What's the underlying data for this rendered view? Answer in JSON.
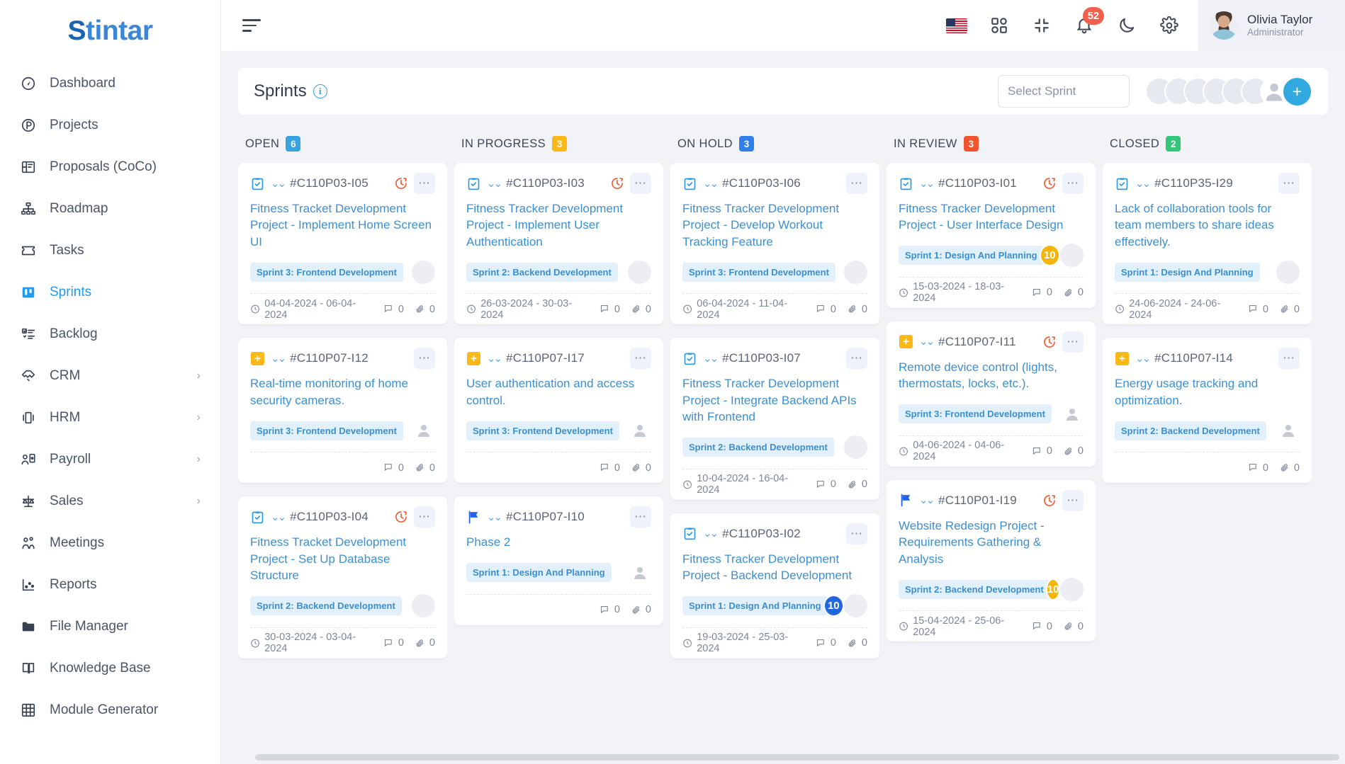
{
  "brand": {
    "mark": "S",
    "rest": "tintar",
    "full": "Stintar"
  },
  "sidebar": {
    "items": [
      {
        "label": "Dashboard",
        "icon": "speedometer-icon",
        "active": false,
        "chevron": false
      },
      {
        "label": "Projects",
        "icon": "circle-p-icon",
        "active": false,
        "chevron": false
      },
      {
        "label": "Proposals (CoCo)",
        "icon": "proposal-icon",
        "active": false,
        "chevron": false
      },
      {
        "label": "Roadmap",
        "icon": "sitemap-icon",
        "active": false,
        "chevron": false
      },
      {
        "label": "Tasks",
        "icon": "ticket-icon",
        "active": false,
        "chevron": false
      },
      {
        "label": "Sprints",
        "icon": "board-icon",
        "active": true,
        "chevron": false
      },
      {
        "label": "Backlog",
        "icon": "checklist-icon",
        "active": false,
        "chevron": false
      },
      {
        "label": "CRM",
        "icon": "handshake-icon",
        "active": false,
        "chevron": true
      },
      {
        "label": "HRM",
        "icon": "hrm-icon",
        "active": false,
        "chevron": true
      },
      {
        "label": "Payroll",
        "icon": "payroll-icon",
        "active": false,
        "chevron": true
      },
      {
        "label": "Sales",
        "icon": "scales-icon",
        "active": false,
        "chevron": true
      },
      {
        "label": "Meetings",
        "icon": "people-icon",
        "active": false,
        "chevron": false
      },
      {
        "label": "Reports",
        "icon": "chart-icon",
        "active": false,
        "chevron": false
      },
      {
        "label": "File Manager",
        "icon": "folder-icon",
        "active": false,
        "chevron": false
      },
      {
        "label": "Knowledge Base",
        "icon": "book-icon",
        "active": false,
        "chevron": false
      },
      {
        "label": "Module Generator",
        "icon": "grid-icon",
        "active": false,
        "chevron": false
      }
    ]
  },
  "topbar": {
    "menu_toggle": "hamburger-icon",
    "language_flag": "us-flag-icon",
    "apps": "apps-grid-icon",
    "fullscreen": "compress-icon",
    "notifications": {
      "icon": "bell-icon",
      "count": "52"
    },
    "theme": "moon-icon",
    "settings": "gear-icon",
    "user": {
      "name": "Olivia Taylor",
      "role": "Administrator",
      "avatar": "user-avatar"
    }
  },
  "sprints_header": {
    "title": "Sprints",
    "info_icon": "info-icon",
    "select_placeholder": "Select Sprint",
    "select_value": "",
    "member_count": 6,
    "add_member_label": "+"
  },
  "colors": {
    "open": "#36a2e0",
    "in_progress": "#fcb816",
    "on_hold": "#2f80ed",
    "in_review": "#f2542d",
    "closed": "#34c77b",
    "accent": "#31a8e0",
    "link": "#3d8fd4",
    "notification": "#f25f4c"
  },
  "board": {
    "columns": [
      {
        "title": "OPEN",
        "count": "6",
        "color": "#36a2e0",
        "cards": [
          {
            "type_icon": "task-check-icon",
            "id": "#C110P03-I05",
            "overdue": true,
            "title": "Fitness Tracket Development Project - Implement Home Screen UI",
            "sprint": "Sprint 3: Frontend Development",
            "badge": null,
            "assignee": true,
            "dates": "04-04-2024 - 06-04-2024",
            "comments": "0",
            "attachments": "0"
          },
          {
            "type_icon": "plus-square-icon",
            "id": "#C110P07-I12",
            "overdue": false,
            "title": "Real-time monitoring of home security cameras.",
            "sprint": "Sprint 3: Frontend Development",
            "badge": null,
            "assignee": false,
            "dates": "",
            "comments": "0",
            "attachments": "0"
          },
          {
            "type_icon": "task-check-icon",
            "id": "#C110P03-I04",
            "overdue": true,
            "title": "Fitness Tracket Development Project - Set Up Database Structure",
            "sprint": "Sprint 2: Backend Development",
            "badge": null,
            "assignee": true,
            "dates": "30-03-2024 - 03-04-2024",
            "comments": "0",
            "attachments": "0"
          }
        ]
      },
      {
        "title": "IN PROGRESS",
        "count": "3",
        "color": "#fcb816",
        "cards": [
          {
            "type_icon": "task-check-icon",
            "id": "#C110P03-I03",
            "overdue": true,
            "title": "Fitness Tracker Development Project - Implement User Authentication",
            "sprint": "Sprint 2: Backend Development",
            "badge": null,
            "assignee": true,
            "dates": "26-03-2024 - 30-03-2024",
            "comments": "0",
            "attachments": "0"
          },
          {
            "type_icon": "plus-square-icon",
            "id": "#C110P07-I17",
            "overdue": false,
            "title": "User authentication and access control.",
            "sprint": "Sprint 3: Frontend Development",
            "badge": null,
            "assignee": false,
            "dates": "",
            "comments": "0",
            "attachments": "0"
          },
          {
            "type_icon": "flag-icon",
            "id": "#C110P07-I10",
            "overdue": false,
            "title": "Phase 2",
            "sprint": "Sprint 1: Design And Planning",
            "badge": null,
            "assignee": false,
            "dates": "",
            "comments": "0",
            "attachments": "0"
          }
        ]
      },
      {
        "title": "ON HOLD",
        "count": "3",
        "color": "#2f80ed",
        "cards": [
          {
            "type_icon": "task-check-icon",
            "id": "#C110P03-I06",
            "overdue": false,
            "title": "Fitness Tracker Development Project - Develop Workout Tracking Feature",
            "sprint": "Sprint 3: Frontend Development",
            "badge": null,
            "assignee": true,
            "dates": "06-04-2024 - 11-04-2024",
            "comments": "0",
            "attachments": "0"
          },
          {
            "type_icon": "task-check-icon",
            "id": "#C110P03-I07",
            "overdue": false,
            "title": "Fitness Tracker Development Project - Integrate Backend APIs with Frontend",
            "sprint": "Sprint 2: Backend Development",
            "badge": null,
            "assignee": true,
            "dates": "10-04-2024 - 16-04-2024",
            "comments": "0",
            "attachments": "0"
          },
          {
            "type_icon": "task-check-icon",
            "id": "#C110P03-I02",
            "overdue": false,
            "title": "Fitness Tracker Development Project - Backend Development",
            "sprint": "Sprint 1: Design And Planning",
            "badge": {
              "value": "10",
              "color": "#2267dd"
            },
            "assignee": true,
            "dates": "19-03-2024 - 25-03-2024",
            "comments": "0",
            "attachments": "0"
          }
        ]
      },
      {
        "title": "IN REVIEW",
        "count": "3",
        "color": "#f2542d",
        "cards": [
          {
            "type_icon": "task-check-icon",
            "id": "#C110P03-I01",
            "overdue": true,
            "title": "Fitness Tracker Development Project - User Interface Design",
            "sprint": "Sprint 1: Design And Planning",
            "badge": {
              "value": "10",
              "color": "#f5b50a"
            },
            "assignee": true,
            "dates": "15-03-2024 - 18-03-2024",
            "comments": "0",
            "attachments": "0"
          },
          {
            "type_icon": "plus-square-icon",
            "id": "#C110P07-I11",
            "overdue": true,
            "title": "Remote device control (lights, thermostats, locks, etc.).",
            "sprint": "Sprint 3: Frontend Development",
            "badge": null,
            "assignee": false,
            "dates": "04-06-2024 - 04-06-2024",
            "comments": "0",
            "attachments": "0"
          },
          {
            "type_icon": "flag-icon",
            "id": "#C110P01-I19",
            "overdue": true,
            "title": "Website Redesign Project - Requirements Gathering & Analysis",
            "sprint": "Sprint 2: Backend Development",
            "badge": {
              "value": "10",
              "color": "#f5b50a"
            },
            "assignee": true,
            "dates": "15-04-2024 - 25-06-2024",
            "comments": "0",
            "attachments": "0"
          }
        ]
      },
      {
        "title": "CLOSED",
        "count": "2",
        "color": "#34c77b",
        "cards": [
          {
            "type_icon": "task-check-icon",
            "id": "#C110P35-I29",
            "overdue": false,
            "title": "Lack of collaboration tools for team members to share ideas effectively.",
            "sprint": "Sprint 1: Design And Planning",
            "badge": null,
            "assignee": true,
            "dates": "24-06-2024 - 24-06-2024",
            "comments": "0",
            "attachments": "0"
          },
          {
            "type_icon": "plus-square-icon",
            "id": "#C110P07-I14",
            "overdue": false,
            "title": "Energy usage tracking and optimization.",
            "sprint": "Sprint 2: Backend Development",
            "badge": null,
            "assignee": false,
            "dates": "",
            "comments": "0",
            "attachments": "0"
          }
        ]
      }
    ]
  }
}
